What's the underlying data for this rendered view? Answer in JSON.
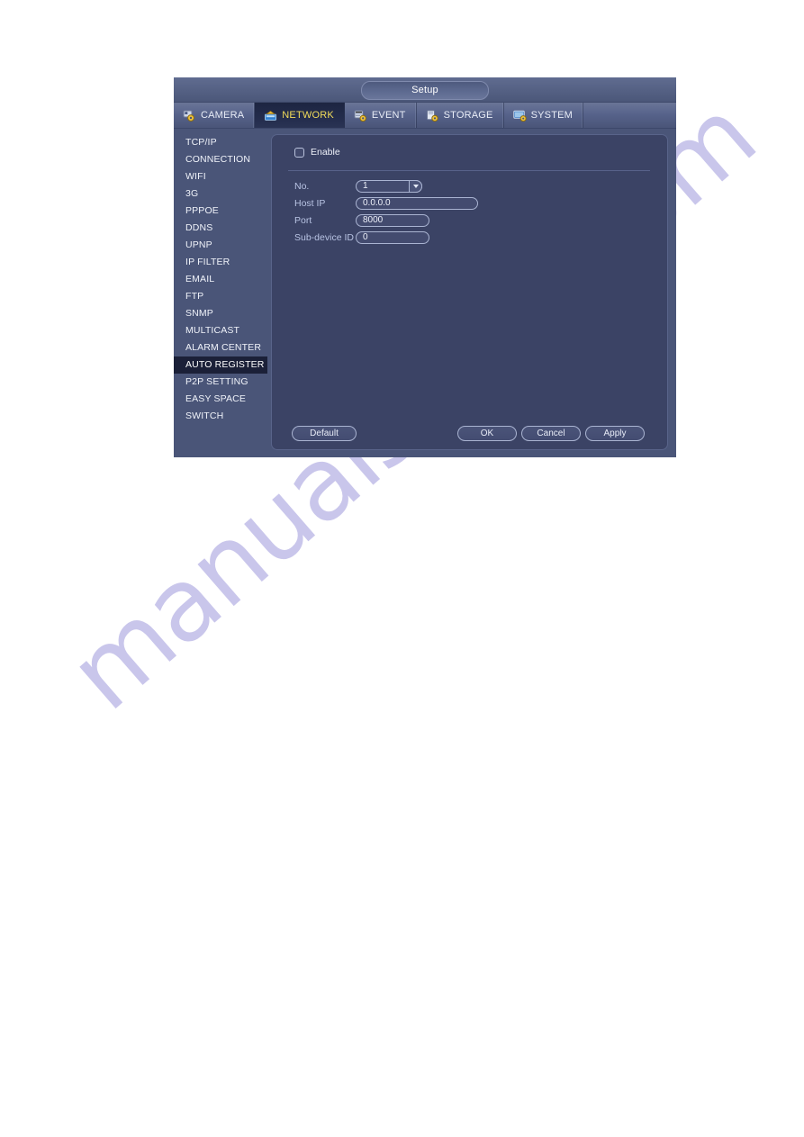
{
  "watermark": {
    "text": "manualshive.com",
    "color": "#c7c4ea"
  },
  "dialog": {
    "title": "Setup",
    "tabs": [
      {
        "label": "CAMERA",
        "icon": "camera-icon",
        "active": false
      },
      {
        "label": "NETWORK",
        "icon": "network-icon",
        "active": true
      },
      {
        "label": "EVENT",
        "icon": "event-icon",
        "active": false
      },
      {
        "label": "STORAGE",
        "icon": "storage-icon",
        "active": false
      },
      {
        "label": "SYSTEM",
        "icon": "system-icon",
        "active": false
      }
    ],
    "sidebar": {
      "selected": "AUTO REGISTER",
      "items": [
        {
          "label": "TCP/IP"
        },
        {
          "label": "CONNECTION"
        },
        {
          "label": "WIFI"
        },
        {
          "label": "3G"
        },
        {
          "label": "PPPOE"
        },
        {
          "label": "DDNS"
        },
        {
          "label": "UPNP"
        },
        {
          "label": "IP FILTER"
        },
        {
          "label": "EMAIL"
        },
        {
          "label": "FTP"
        },
        {
          "label": "SNMP"
        },
        {
          "label": "MULTICAST"
        },
        {
          "label": "ALARM CENTER"
        },
        {
          "label": "AUTO REGISTER"
        },
        {
          "label": "P2P SETTING"
        },
        {
          "label": "EASY SPACE"
        },
        {
          "label": "SWITCH"
        }
      ]
    },
    "form": {
      "enable": {
        "label": "Enable",
        "checked": false
      },
      "no": {
        "label": "No.",
        "value": "1"
      },
      "host_ip": {
        "label": "Host IP",
        "value": "0.0.0.0"
      },
      "port": {
        "label": "Port",
        "value": "8000"
      },
      "sub_device_id": {
        "label": "Sub-device ID",
        "value": "0"
      }
    },
    "buttons": {
      "default": "Default",
      "ok": "OK",
      "cancel": "Cancel",
      "apply": "Apply"
    },
    "colors": {
      "dialog_bg": "#4a5578",
      "panel_bg": "#3b4365",
      "selected_item_bg": "#1b2038",
      "active_tab_text": "#f2dc5a"
    }
  }
}
